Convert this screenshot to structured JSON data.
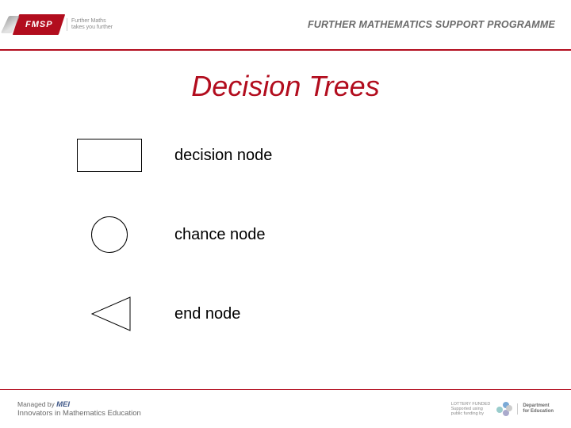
{
  "header": {
    "badge": "FMSP",
    "tagline": "Further Maths\ntakes you further",
    "programme": "FURTHER MATHEMATICS SUPPORT PROGRAMME"
  },
  "title": "Decision Trees",
  "legend": [
    {
      "label": "decision node"
    },
    {
      "label": "chance node"
    },
    {
      "label": "end node"
    }
  ],
  "footer": {
    "managed_line1": "Managed by ",
    "managed_mei": "MEI",
    "managed_line2": "Innovators in Mathematics Education",
    "lottery": "LOTTERY FUNDED\nSupported using\npublic funding by",
    "dfe": "Department\nfor Education"
  }
}
